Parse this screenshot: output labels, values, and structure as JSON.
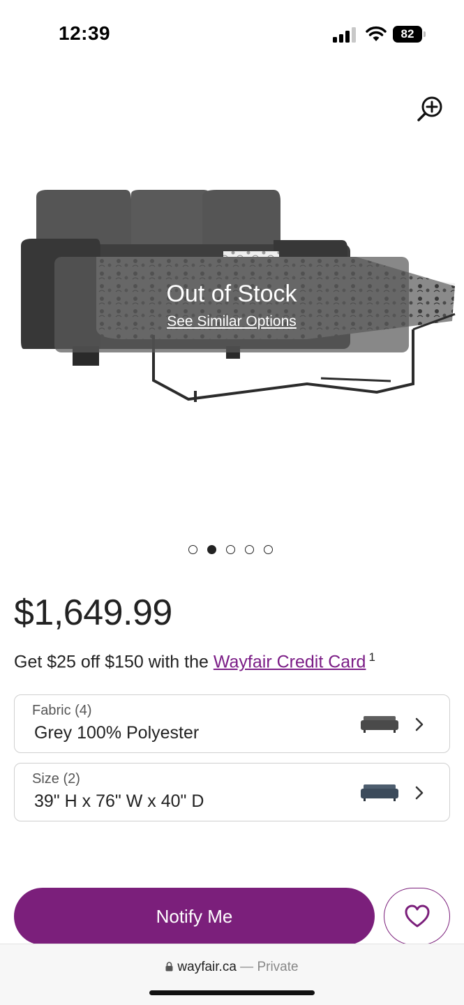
{
  "status_bar": {
    "time": "12:39",
    "battery": "82"
  },
  "product": {
    "stock_status": "Out of Stock",
    "similar_link": "See Similar Options",
    "carousel": {
      "count": 5,
      "active_index": 1
    },
    "price": "$1,649.99",
    "promo": {
      "text": "Get $25 off $150 with the ",
      "link": "Wayfair Credit Card",
      "footnote": "1"
    }
  },
  "options": {
    "fabric": {
      "label": "Fabric (4)",
      "value": "Grey 100% Polyester"
    },
    "size": {
      "label": "Size (2)",
      "value": "39\" H x 76\" W x 40\" D"
    }
  },
  "actions": {
    "notify_label": "Notify Me"
  },
  "browser": {
    "domain": "wayfair.ca",
    "private": " — Private"
  },
  "colors": {
    "brand": "#7b1f7b",
    "link": "#7b1d86"
  },
  "icons": [
    "signal-icon",
    "wifi-icon",
    "battery-icon",
    "zoom-in-icon",
    "chevron-right-icon",
    "heart-icon",
    "lock-icon"
  ]
}
